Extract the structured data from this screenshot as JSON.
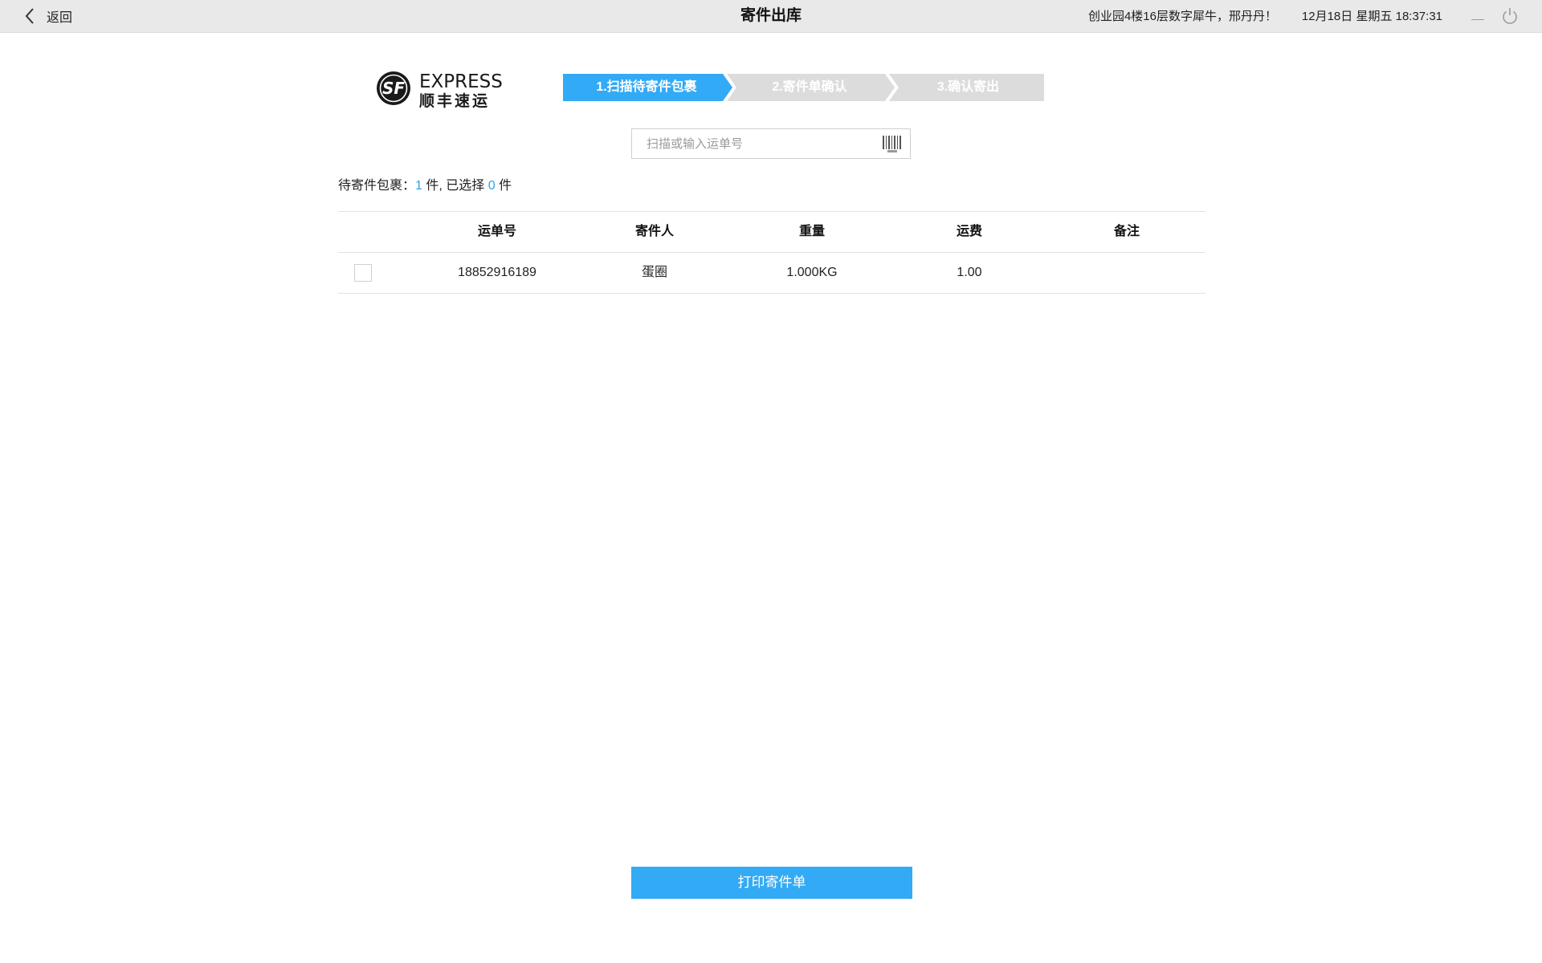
{
  "topbar": {
    "back_label": "返回",
    "title": "寄件出库",
    "greeting": "创业园4楼16层数字犀牛，邢丹丹！",
    "datetime": "12月18日 星期五 18:37:31"
  },
  "logo": {
    "brand_en": "EXPRESS",
    "brand_cn": "顺丰速运",
    "mark": "SF"
  },
  "steps": [
    {
      "label": "1.扫描待寄件包裹",
      "state": "active"
    },
    {
      "label": "2.寄件单确认",
      "state": "inactive"
    },
    {
      "label": "3.确认寄出",
      "state": "inactive"
    }
  ],
  "colors": {
    "accent": "#33aaf5",
    "step_inactive": "#dcdcdc",
    "topbar": "#e9e9e9"
  },
  "search": {
    "placeholder": "扫描或输入运单号",
    "value": ""
  },
  "summary": {
    "prefix": "待寄件包裹：",
    "pending_count": "1",
    "mid": " 件, 已选择 ",
    "selected_count": "0",
    "suffix": " 件"
  },
  "table": {
    "columns": [
      "运单号",
      "寄件人",
      "重量",
      "运费",
      "备注"
    ],
    "rows": [
      {
        "checked": false,
        "waybill": "18852916189",
        "sender": "蛋圈",
        "weight": "1.000KG",
        "fee": "1.00",
        "remark": ""
      }
    ]
  },
  "actions": {
    "print_label": "打印寄件单"
  },
  "icons": {
    "back": "chevron-left-icon",
    "minimize": "minimize-icon",
    "power": "power-icon",
    "barcode": "barcode-icon"
  }
}
